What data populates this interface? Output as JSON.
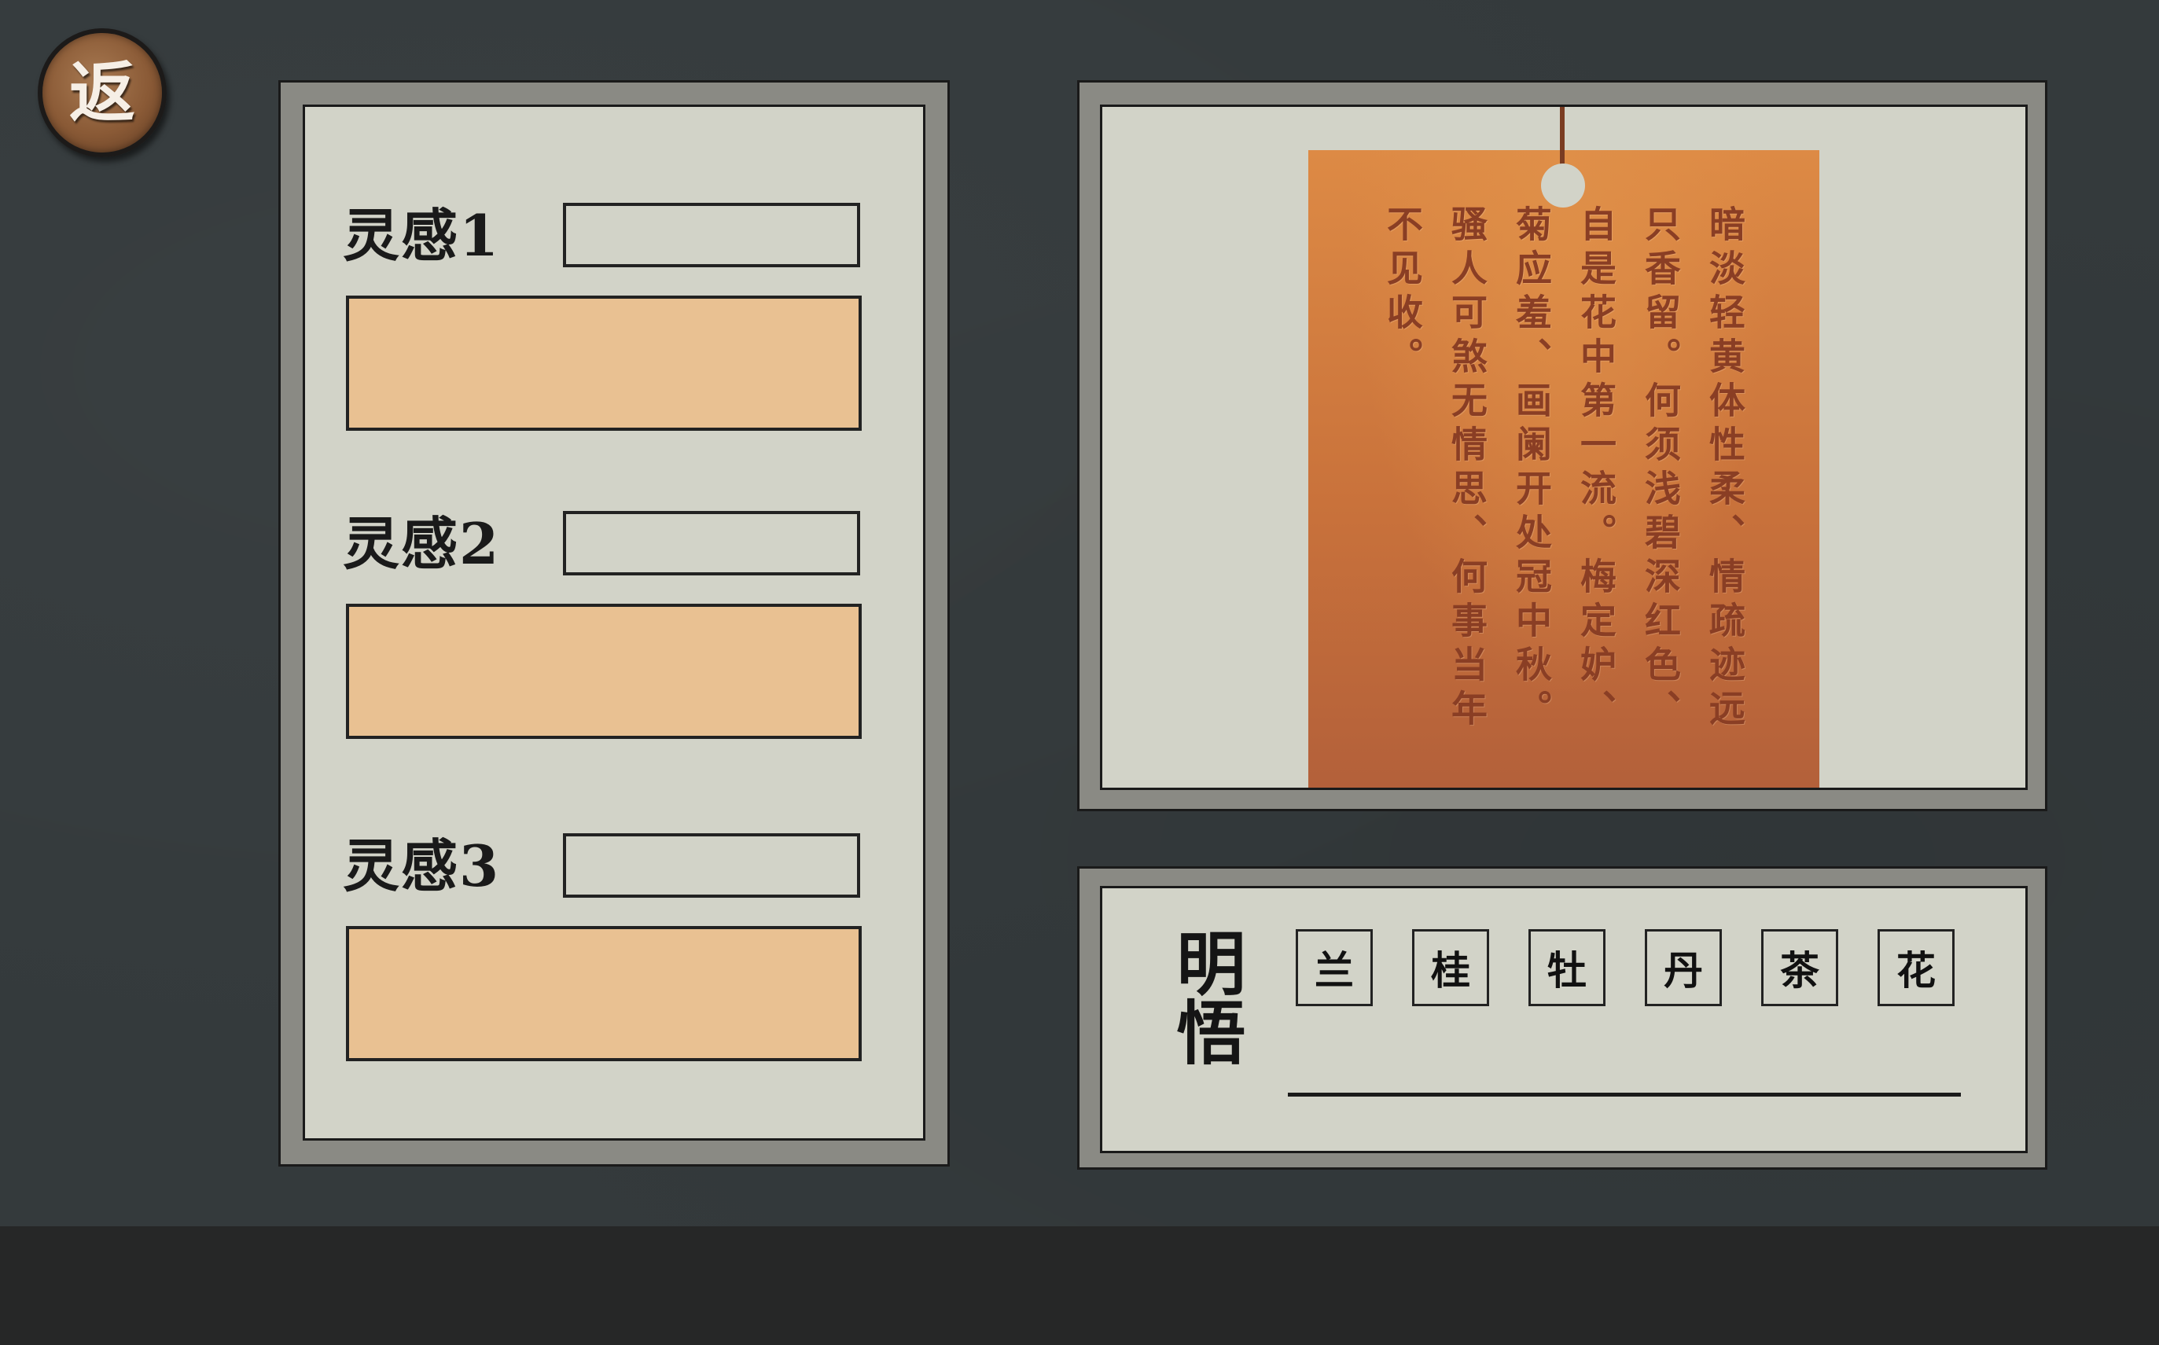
{
  "back_button": {
    "label": "返"
  },
  "inspiration_panel": {
    "slots": [
      {
        "label": "灵感1",
        "name_value": "",
        "content_value": ""
      },
      {
        "label": "灵感2",
        "name_value": "",
        "content_value": ""
      },
      {
        "label": "灵感3",
        "name_value": "",
        "content_value": ""
      }
    ]
  },
  "poem": {
    "columns": [
      "暗淡轻黄体性柔、情疏迹远",
      "只香留。何须浅碧深红色、",
      "自是花中第一流。梅定妒、",
      "菊应羞、画阑开处冠中秋。",
      "骚人可煞无情思、何事当年",
      "不见收。"
    ]
  },
  "realization_panel": {
    "title": "明悟",
    "choices": [
      "兰",
      "桂",
      "牡",
      "丹",
      "茶",
      "花"
    ],
    "answer": ""
  }
}
